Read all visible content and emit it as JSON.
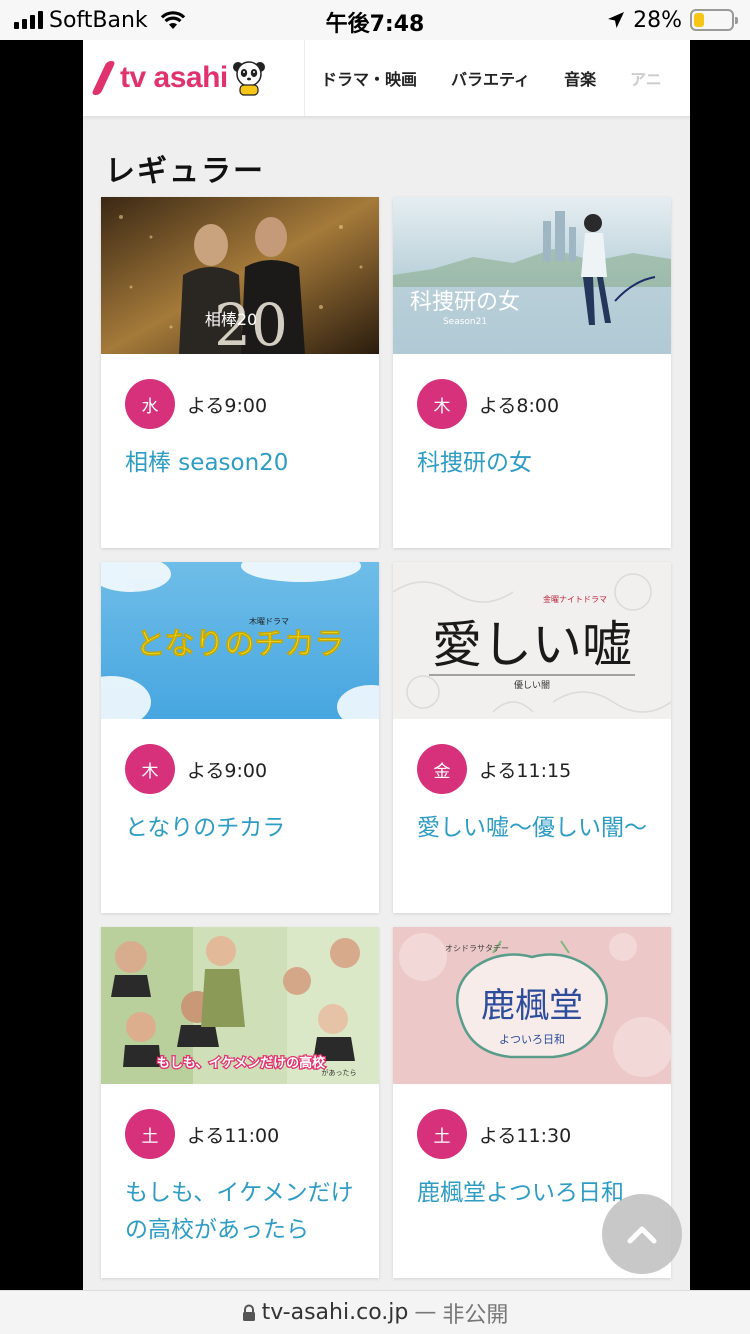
{
  "status_bar": {
    "carrier": "SoftBank",
    "time": "午後7:48",
    "battery_percent": "28%",
    "battery_level": 0.28
  },
  "header": {
    "logo_text": "tv asahi",
    "nav": [
      "ドラマ・映画",
      "バラエティ",
      "音楽",
      "アニ"
    ]
  },
  "section": {
    "title": "レギュラー",
    "cards": [
      {
        "day": "水",
        "time": "よる9:00",
        "title": "相棒 season20",
        "thumb_text": "相棒20"
      },
      {
        "day": "木",
        "time": "よる8:00",
        "title": "科捜研の女",
        "thumb_text": "科捜研の女",
        "thumb_sub": "Season21"
      },
      {
        "day": "木",
        "time": "よる9:00",
        "title": "となりのチカラ",
        "thumb_text": "となりのチカラ",
        "thumb_sub": "木曜ドラマ"
      },
      {
        "day": "金",
        "time": "よる11:15",
        "title": "愛しい嘘～優しい闇～",
        "thumb_text": "愛しい嘘",
        "thumb_sub": "優しい闇",
        "thumb_tag": "金曜ナイトドラマ"
      },
      {
        "day": "土",
        "time": "よる11:00",
        "title": "もしも、イケメンだけの高校があったら",
        "thumb_text": "もしも、イケメンだけの高校",
        "thumb_sub": "があったら"
      },
      {
        "day": "土",
        "time": "よる11:30",
        "title": "鹿楓堂よついろ日和",
        "thumb_text": "鹿楓堂",
        "thumb_sub": "よついろ日和",
        "thumb_tag": "オシドラサタデー"
      }
    ]
  },
  "url_bar": {
    "domain": "tv-asahi.co.jp",
    "separator": "—",
    "private_label": "非公開"
  },
  "icons": [
    "signal-icon",
    "wifi-icon",
    "location-icon",
    "battery-icon",
    "mascot-icon",
    "lock-icon",
    "chevron-up-icon"
  ],
  "colors": {
    "brand": "#e0336e",
    "day_badge": "#d6317a",
    "link": "#2f9cc4"
  }
}
